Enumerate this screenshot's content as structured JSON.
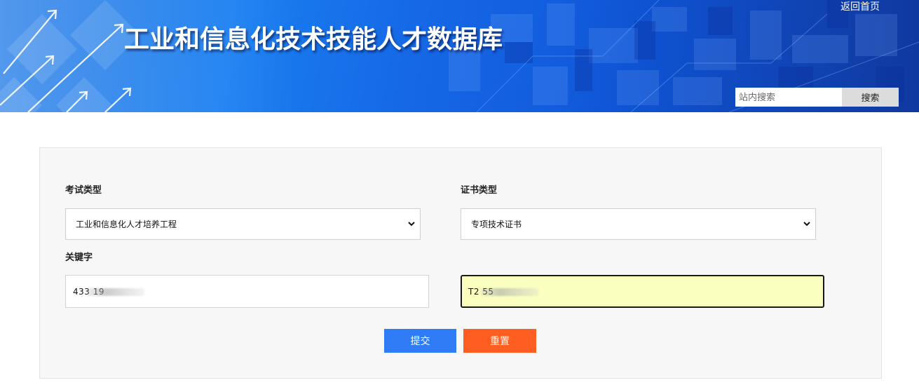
{
  "header": {
    "site_title": "工业和信息化技术技能人才数据库",
    "back_home_label": "返回首页",
    "search_placeholder": "站内搜索",
    "search_button_label": "搜索"
  },
  "form": {
    "exam_type": {
      "label": "考试类型",
      "selected": "工业和信息化人才培养工程"
    },
    "cert_type": {
      "label": "证书类型",
      "selected": "专项技术证书"
    },
    "keyword": {
      "label": "关键字",
      "id_number_visible": "433 19",
      "cert_number_visible": "T2 55"
    },
    "submit_label": "提交",
    "reset_label": "重置"
  },
  "colors": {
    "banner_blue": "#1a6fe8",
    "submit_blue": "#2f7cf6",
    "reset_orange": "#ff5e22",
    "highlight_field": "#fafebf"
  }
}
